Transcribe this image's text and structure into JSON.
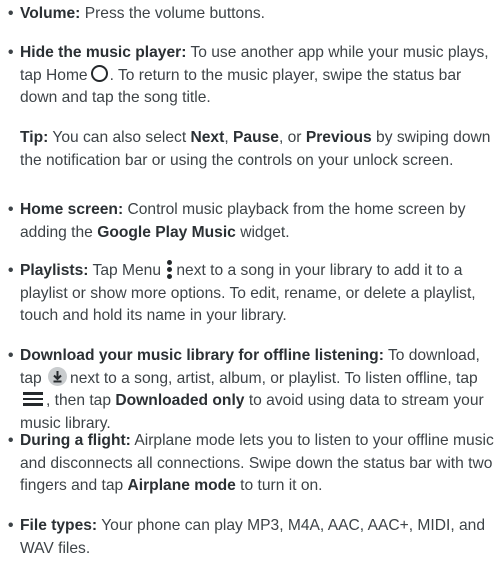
{
  "items": {
    "volume": {
      "term": "Volume:",
      "text": "Press the volume buttons."
    },
    "hide": {
      "term": "Hide the music player:",
      "text_a": "To use another app while your music plays, tap Home",
      "text_b": ". To return to the music player, swipe the status bar down and tap the song title."
    },
    "tip": {
      "label": "Tip:",
      "text_a": "You can also select",
      "next": "Next",
      "comma1": ",",
      "pause": "Pause",
      "text_or": ", or",
      "previous": "Previous",
      "text_b": "by swiping down the notification bar or using the controls on your unlock screen."
    },
    "home_screen": {
      "term": "Home screen:",
      "text_a": "Control music playback from the home screen by adding the",
      "widget": "Google Play Music",
      "text_b": "widget."
    },
    "playlists": {
      "term": "Playlists:",
      "text_a": "Tap Menu",
      "text_b": "next to a song in your library to add it to a playlist or show more options. To edit, rename, or delete a playlist, touch and hold its name in your library."
    },
    "download": {
      "term": "Download your music library for offline listening:",
      "text_a": "To download, tap",
      "text_b": "next to a song, artist, album, or playlist. To listen offline, tap",
      "text_c": ", then tap",
      "downloaded_only": "Downloaded only",
      "text_d": "to avoid using data to stream your music library."
    },
    "flight": {
      "term": "During a flight:",
      "text_a": "Airplane mode lets you to listen to your offline music and disconnects all connections. Swipe down the status bar with two fingers and tap",
      "airplane_mode": "Airplane mode",
      "text_b": "to turn it on."
    },
    "file_types": {
      "term": "File types:",
      "text": "Your phone can play MP3, M4A, AAC, AAC+, MIDI, and WAV files."
    }
  },
  "bullet_char": "•",
  "icons": [
    "home-icon",
    "menu-icon",
    "download-icon",
    "hamburger-icon"
  ]
}
